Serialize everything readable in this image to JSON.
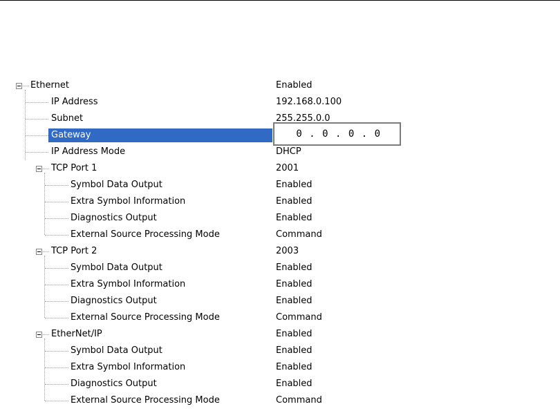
{
  "tree": {
    "ethernet": {
      "label": "Ethernet",
      "value": "Enabled"
    },
    "ip_address": {
      "label": "IP Address",
      "value": "192.168.0.100"
    },
    "subnet": {
      "label": "Subnet",
      "value": "255.255.0.0"
    },
    "gateway": {
      "label": "Gateway",
      "editor_value": " 0 . 0 . 0 . 0"
    },
    "ip_address_mode": {
      "label": "IP Address Mode",
      "value": "DHCP"
    },
    "tcp_port_1": {
      "label": "TCP Port 1",
      "value": "2001",
      "children": [
        {
          "label": "Symbol Data Output",
          "value": "Enabled"
        },
        {
          "label": "Extra Symbol Information",
          "value": "Enabled"
        },
        {
          "label": "Diagnostics Output",
          "value": "Enabled"
        },
        {
          "label": "External Source Processing Mode",
          "value": "Command"
        }
      ]
    },
    "tcp_port_2": {
      "label": "TCP Port 2",
      "value": "2003",
      "children": [
        {
          "label": "Symbol Data Output",
          "value": "Enabled"
        },
        {
          "label": "Extra Symbol Information",
          "value": "Enabled"
        },
        {
          "label": "Diagnostics Output",
          "value": "Enabled"
        },
        {
          "label": "External Source Processing Mode",
          "value": "Command"
        }
      ]
    },
    "ethernet_ip": {
      "label": "EtherNet/IP",
      "value": "Enabled",
      "children": [
        {
          "label": "Symbol Data Output",
          "value": "Enabled"
        },
        {
          "label": "Extra Symbol Information",
          "value": "Enabled"
        },
        {
          "label": "Diagnostics Output",
          "value": "Enabled"
        },
        {
          "label": "External Source Processing Mode",
          "value": "Command"
        }
      ]
    }
  },
  "colors": {
    "selection": "#316ac5",
    "tree_lines": "#9c9c9c"
  },
  "icons": {
    "expander": "collapse-minus-icon"
  }
}
